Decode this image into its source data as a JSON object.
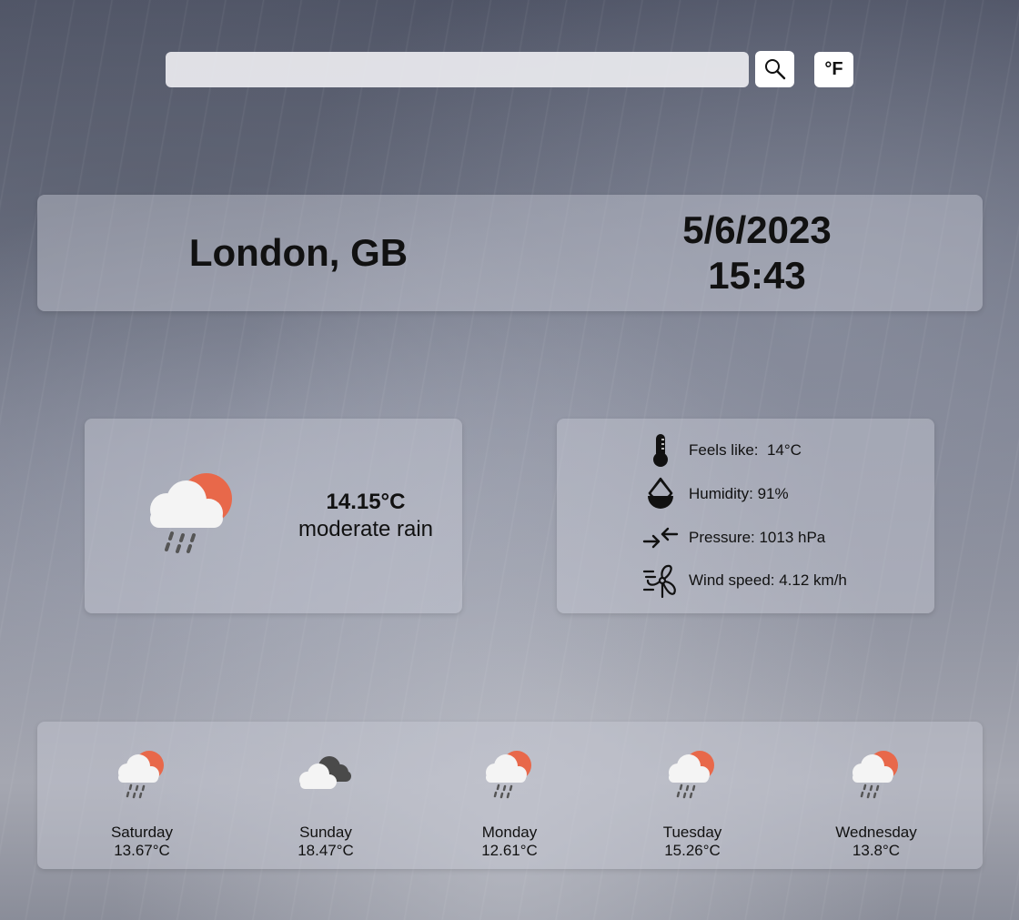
{
  "search": {
    "value": "",
    "placeholder": ""
  },
  "unit_toggle": {
    "label": "°F"
  },
  "location": {
    "city": "London, GB",
    "date": "5/6/2023",
    "time": "15:43"
  },
  "current": {
    "icon": "sun-cloud-rain-icon",
    "temperature": "14.15°C",
    "description": "moderate rain"
  },
  "details": {
    "feels_like": "Feels like:  14°C",
    "humidity": "Humidity: 91%",
    "pressure": "Pressure: 1013 hPa",
    "wind_speed": "Wind speed: 4.12 km/h"
  },
  "forecast": [
    {
      "day": "Saturday",
      "temp": "13.67°C",
      "icon": "sun-cloud-rain-icon"
    },
    {
      "day": "Sunday",
      "temp": "18.47°C",
      "icon": "clouds-icon"
    },
    {
      "day": "Monday",
      "temp": "12.61°C",
      "icon": "sun-cloud-rain-icon"
    },
    {
      "day": "Tuesday",
      "temp": "15.26°C",
      "icon": "sun-cloud-rain-icon"
    },
    {
      "day": "Wednesday",
      "temp": "13.8°C",
      "icon": "sun-cloud-rain-icon"
    }
  ],
  "colors": {
    "sun": "#e8684a",
    "cloud": "#f2f2f2",
    "dark_cloud": "#4a4a4a",
    "rain": "#555555"
  }
}
